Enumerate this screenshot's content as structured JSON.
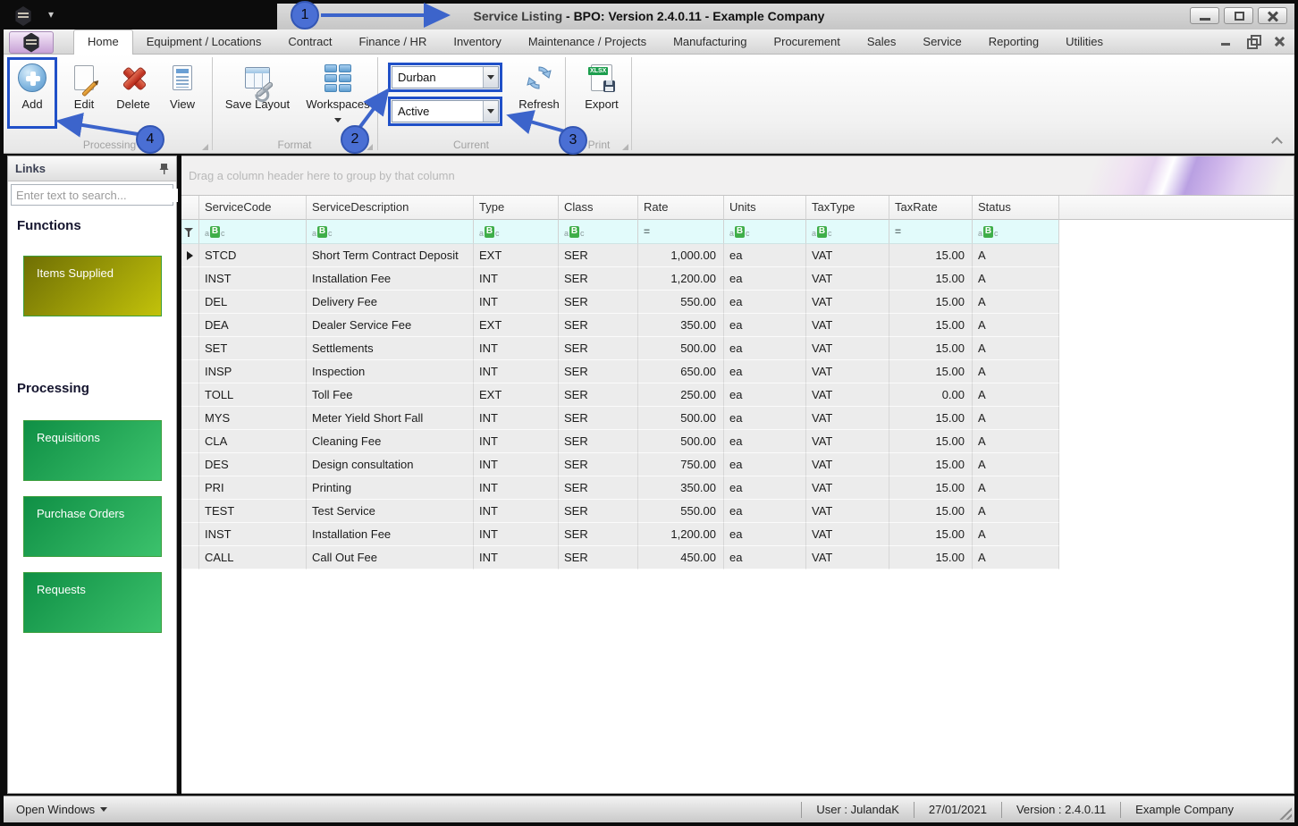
{
  "window": {
    "title_page": "Service Listing",
    "title_rest": " - BPO: Version 2.4.0.11 - Example Company",
    "app_chevron": "▾"
  },
  "tabs": [
    {
      "label": "Home",
      "active": true
    },
    {
      "label": "Equipment / Locations"
    },
    {
      "label": "Contract"
    },
    {
      "label": "Finance / HR"
    },
    {
      "label": "Inventory"
    },
    {
      "label": "Maintenance / Projects"
    },
    {
      "label": "Manufacturing"
    },
    {
      "label": "Procurement"
    },
    {
      "label": "Sales"
    },
    {
      "label": "Service"
    },
    {
      "label": "Reporting"
    },
    {
      "label": "Utilities"
    }
  ],
  "ribbon": {
    "buttons": {
      "add": "Add",
      "edit": "Edit",
      "delete": "Delete",
      "view": "View",
      "save_layout": "Save Layout",
      "workspaces": "Workspaces",
      "refresh": "Refresh",
      "export": "Export"
    },
    "group_labels": {
      "processing": "Processing",
      "format": "Format",
      "current": "Current",
      "print": "Print"
    },
    "dropdowns": {
      "branch": "Durban",
      "status": "Active"
    },
    "export_icon_text": "XLSX"
  },
  "sidebar": {
    "header": "Links",
    "search_placeholder": "Enter text to search...",
    "sections": [
      {
        "heading": "Functions",
        "buttons": [
          {
            "label": "Items Supplied",
            "style": "olive"
          }
        ]
      },
      {
        "heading": "Processing",
        "buttons": [
          {
            "label": "Requisitions",
            "style": "green"
          },
          {
            "label": "Purchase Orders",
            "style": "green"
          },
          {
            "label": "Requests",
            "style": "green"
          }
        ]
      }
    ]
  },
  "grid": {
    "group_by_hint": "Drag a column header here to group by that column",
    "columns": [
      "ServiceCode",
      "ServiceDescription",
      "Type",
      "Class",
      "Rate",
      "Units",
      "TaxType",
      "TaxRate",
      "Status"
    ],
    "filter_row": [
      "abc",
      "abc",
      "abc",
      "abc",
      "eq",
      "abc",
      "abc",
      "eq",
      "abc"
    ],
    "filter_glyphs": {
      "abc": [
        "a",
        "B",
        "c"
      ],
      "eq": "="
    },
    "rows": [
      [
        "STCD",
        "Short Term Contract Deposit",
        "EXT",
        "SER",
        "1,000.00",
        "ea",
        "VAT",
        "15.00",
        "A"
      ],
      [
        "INST",
        "Installation Fee",
        "INT",
        "SER",
        "1,200.00",
        "ea",
        "VAT",
        "15.00",
        "A"
      ],
      [
        "DEL",
        "Delivery Fee",
        "INT",
        "SER",
        "550.00",
        "ea",
        "VAT",
        "15.00",
        "A"
      ],
      [
        "DEA",
        "Dealer Service Fee",
        "EXT",
        "SER",
        "350.00",
        "ea",
        "VAT",
        "15.00",
        "A"
      ],
      [
        "SET",
        "Settlements",
        "INT",
        "SER",
        "500.00",
        "ea",
        "VAT",
        "15.00",
        "A"
      ],
      [
        "INSP",
        "Inspection",
        "INT",
        "SER",
        "650.00",
        "ea",
        "VAT",
        "15.00",
        "A"
      ],
      [
        "TOLL",
        "Toll Fee",
        "EXT",
        "SER",
        "250.00",
        "ea",
        "VAT",
        "0.00",
        "A"
      ],
      [
        "MYS",
        "Meter Yield Short Fall",
        "INT",
        "SER",
        "500.00",
        "ea",
        "VAT",
        "15.00",
        "A"
      ],
      [
        "CLA",
        "Cleaning Fee",
        "INT",
        "SER",
        "500.00",
        "ea",
        "VAT",
        "15.00",
        "A"
      ],
      [
        "DES",
        "Design consultation",
        "INT",
        "SER",
        "750.00",
        "ea",
        "VAT",
        "15.00",
        "A"
      ],
      [
        "PRI",
        "Printing",
        "INT",
        "SER",
        "350.00",
        "ea",
        "VAT",
        "15.00",
        "A"
      ],
      [
        "TEST",
        "Test Service",
        "INT",
        "SER",
        "550.00",
        "ea",
        "VAT",
        "15.00",
        "A"
      ],
      [
        "INST",
        "Installation Fee",
        "INT",
        "SER",
        "1,200.00",
        "ea",
        "VAT",
        "15.00",
        "A"
      ],
      [
        "CALL",
        "Call Out Fee",
        "INT",
        "SER",
        "450.00",
        "ea",
        "VAT",
        "15.00",
        "A"
      ]
    ]
  },
  "statusbar": {
    "open_windows": "Open Windows",
    "segments": [
      "User : JulandaK",
      "27/01/2021",
      "Version : 2.4.0.11",
      "Example Company"
    ]
  },
  "annotations": [
    {
      "number": "1"
    },
    {
      "number": "2"
    },
    {
      "number": "3"
    },
    {
      "number": "4"
    }
  ],
  "colors": {
    "accent_blue": "#3c64cb",
    "highlight_border": "#2050c8",
    "filter_row_bg": "#e2fbfb",
    "abc_badge_green": "#3fae49",
    "olive_button": "#9c9c10",
    "green_button": "#1f9e52"
  }
}
